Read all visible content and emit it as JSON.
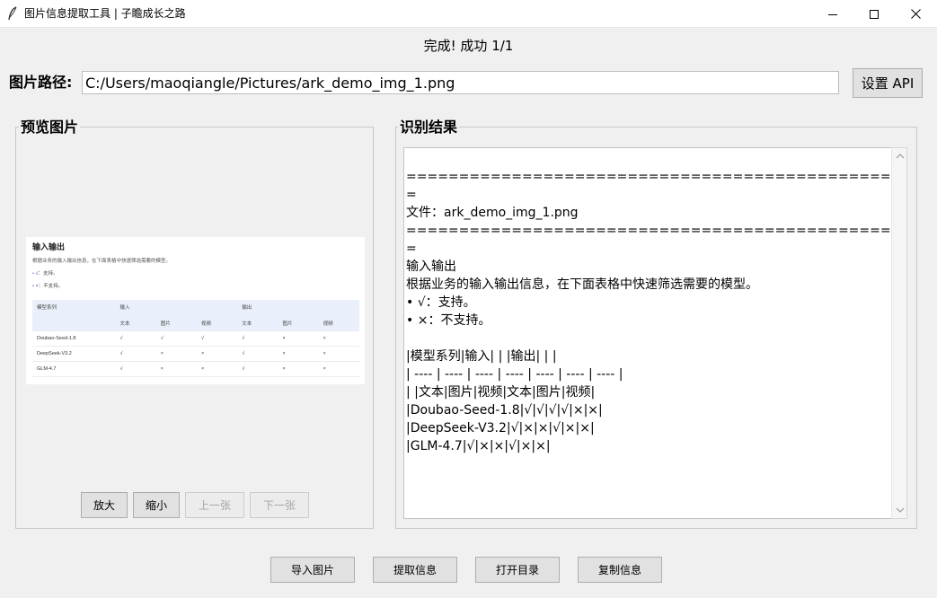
{
  "window": {
    "title": "图片信息提取工具 | 子瞻成长之路",
    "icons": {
      "app": "feather-icon",
      "minimize": "minimize-icon",
      "maximize": "maximize-icon",
      "close": "close-icon"
    }
  },
  "status": "完成! 成功 1/1",
  "path": {
    "label": "图片路径:",
    "value": "C:/Users/maoqiangle/Pictures/ark_demo_img_1.png"
  },
  "api_button": "设置 API",
  "preview": {
    "title": "预览图片",
    "image": {
      "heading": "输入输出",
      "subtitle": "根据业务的输入输出信息，在下面表格中快速筛选需要的模型。",
      "bullets": [
        "√：支持。",
        "×：不支持。"
      ],
      "header_row1": [
        "模型系列",
        "输入",
        "",
        "",
        "输出",
        "",
        ""
      ],
      "header_row2": [
        "",
        "文本",
        "图片",
        "视频",
        "文本",
        "图片",
        "视频"
      ],
      "rows": [
        [
          "Doubao-Seed-1.8",
          "√",
          "√",
          "√",
          "√",
          "×",
          "×"
        ],
        [
          "DeepSeek-V3.2",
          "√",
          "×",
          "×",
          "√",
          "×",
          "×"
        ],
        [
          "GLM-4.7",
          "√",
          "×",
          "×",
          "√",
          "×",
          "×"
        ]
      ]
    },
    "buttons": {
      "zoom_in": "放大",
      "zoom_out": "缩小",
      "prev": "上一张",
      "next": "下一张"
    }
  },
  "result": {
    "title": "识别结果",
    "lines": [
      "",
      "==================================================",
      "=",
      "文件：ark_demo_img_1.png",
      "==================================================",
      "=",
      "输入输出",
      "根据业务的输入输出信息，在下面表格中快速筛选需要的模型。",
      "• √：支持。",
      "• ×：不支持。",
      "",
      "|模型系列|输入| | |输出| | |",
      "| ---- | ---- | ---- | ---- | ---- | ---- | ---- |",
      "| |文本|图片|视频|文本|图片|视频|",
      "|Doubao-Seed-1.8|√|√|√|√|×|×|",
      "|DeepSeek-V3.2|√|×|×|√|×|×|",
      "|GLM-4.7|√|×|×|√|×|×|"
    ]
  },
  "bottom_buttons": {
    "import": "导入图片",
    "extract": "提取信息",
    "open_dir": "打开目录",
    "copy": "复制信息"
  }
}
